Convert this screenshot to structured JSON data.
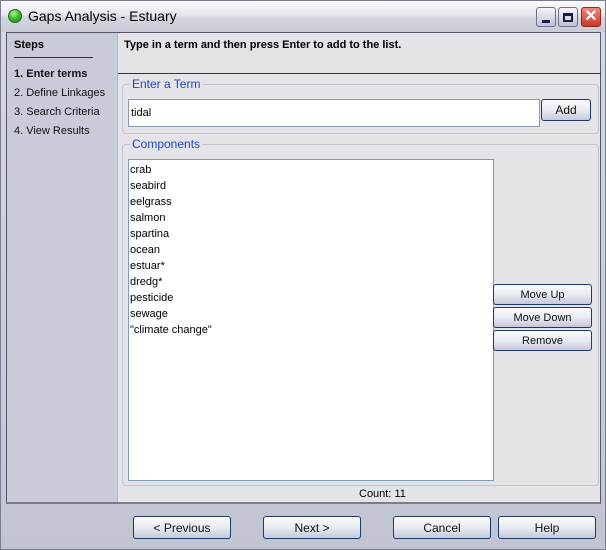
{
  "window": {
    "title": "Gaps Analysis - Estuary",
    "controls": {
      "minimize_icon": "minimize-icon",
      "maximize_icon": "maximize-icon",
      "close_icon": "close-icon",
      "close_glyph": "✕"
    }
  },
  "sidebar": {
    "title": "Steps",
    "items": [
      {
        "label": "1. Enter terms",
        "active": true
      },
      {
        "label": "2. Define Linkages",
        "active": false
      },
      {
        "label": "3. Search Criteria",
        "active": false
      },
      {
        "label": "4. View Results",
        "active": false
      }
    ]
  },
  "main": {
    "instruction": "Type in a term and then press Enter to add to the list.",
    "term_group": {
      "label": "Enter a Term",
      "input_value": "tidal",
      "add_label": "Add"
    },
    "components_group": {
      "label": "Components",
      "items": [
        "crab",
        "seabird",
        "eelgrass",
        "salmon",
        "spartina",
        "ocean",
        "estuar*",
        "dredg*",
        "pesticide",
        "sewage",
        "\"climate change\""
      ],
      "move_up_label": "Move Up",
      "move_down_label": "Move Down",
      "remove_label": "Remove"
    },
    "count_text": "Count: 11"
  },
  "footer": {
    "previous_label": "< Previous",
    "next_label": "Next >",
    "cancel_label": "Cancel",
    "help_label": "Help"
  }
}
